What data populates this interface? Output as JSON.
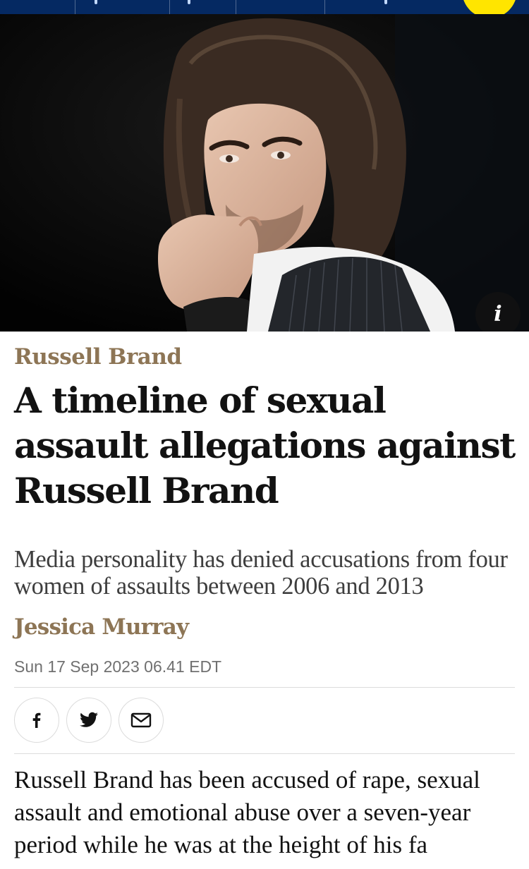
{
  "hero": {
    "info_label": "i"
  },
  "article": {
    "kicker": "Russell Brand",
    "headline": "A timeline of sexual assault allegations against Russell Brand",
    "standfirst": "Media personality has denied accusations from four women of assaults between 2006 and 2013",
    "byline": "Jessica Murray",
    "dateline": "Sun 17 Sep 2023 06.41 EDT",
    "body": "Russell Brand has been accused of rape, sexual assault and emotional abuse over a seven-year period while he was at the height of his fa"
  },
  "share": {
    "icons": [
      "facebook-icon",
      "twitter-icon",
      "email-icon"
    ]
  },
  "colors": {
    "nav": "#052962",
    "accent_yellow": "#ffe500",
    "kicker": "#8d7555",
    "headline": "#121212",
    "standfirst": "#3e3e3e",
    "dateline": "#707070"
  }
}
